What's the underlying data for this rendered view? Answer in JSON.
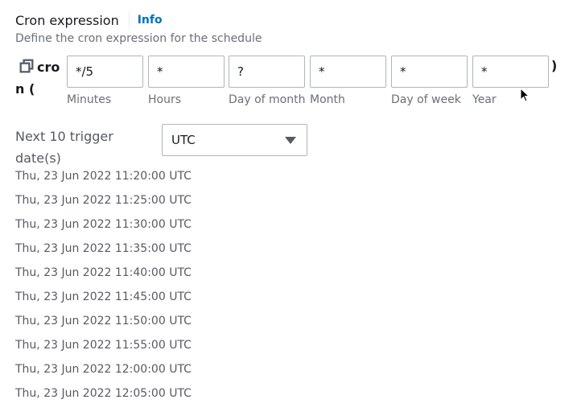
{
  "header": {
    "title": "Cron expression",
    "info_link": "Info",
    "description": "Define the cron expression for the schedule"
  },
  "cron": {
    "prefix": "cron (",
    "suffix": ")",
    "copy_icon": "copy-icon",
    "fields": [
      {
        "label": "Minutes",
        "value": "*/5"
      },
      {
        "label": "Hours",
        "value": "*"
      },
      {
        "label": "Day of month",
        "value": "?"
      },
      {
        "label": "Month",
        "value": "*"
      },
      {
        "label": "Day of week",
        "value": "*"
      },
      {
        "label": "Year",
        "value": "*"
      }
    ]
  },
  "trigger_dates": {
    "label": "Next 10 trigger date(s)",
    "timezone": {
      "selected": "UTC",
      "icon": "caret-down-icon"
    },
    "dates": [
      "Thu, 23 Jun 2022 11:20:00 UTC",
      "Thu, 23 Jun 2022 11:25:00 UTC",
      "Thu, 23 Jun 2022 11:30:00 UTC",
      "Thu, 23 Jun 2022 11:35:00 UTC",
      "Thu, 23 Jun 2022 11:40:00 UTC",
      "Thu, 23 Jun 2022 11:45:00 UTC",
      "Thu, 23 Jun 2022 11:50:00 UTC",
      "Thu, 23 Jun 2022 11:55:00 UTC",
      "Thu, 23 Jun 2022 12:00:00 UTC",
      "Thu, 23 Jun 2022 12:05:00 UTC"
    ]
  },
  "colors": {
    "link": "#0073bb",
    "secondary_text": "#687078",
    "border": "#aab7b8"
  }
}
